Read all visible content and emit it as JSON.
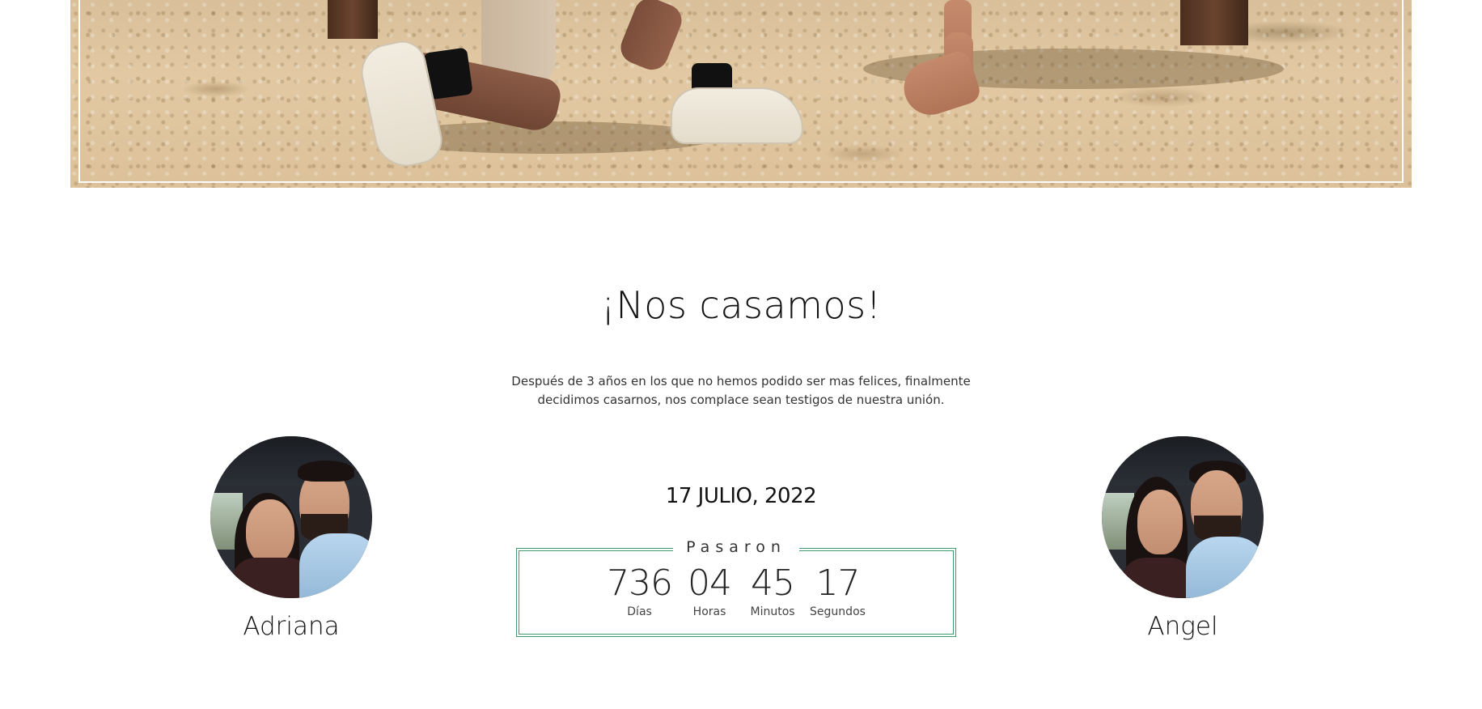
{
  "hero": {
    "image_desc": "beach-proposal-photo"
  },
  "section": {
    "title": "¡Nos casamos!",
    "intro": "Después de 3 años en los que no hemos podido ser mas felices, finalmente decidimos casarnos, nos complace sean testigos de nuestra unión."
  },
  "bride": {
    "name": "Adriana"
  },
  "groom": {
    "name": "Angel"
  },
  "event": {
    "date": "17 JULIO, 2022"
  },
  "countdown": {
    "label": "Pasaron",
    "units": [
      {
        "value": "736",
        "label": "Días"
      },
      {
        "value": "04",
        "label": "Horas"
      },
      {
        "value": "45",
        "label": "Minutos"
      },
      {
        "value": "17",
        "label": "Segundos"
      }
    ]
  },
  "colors": {
    "accent": "#3d9b6e",
    "text": "#111111",
    "background": "#ffffff"
  }
}
